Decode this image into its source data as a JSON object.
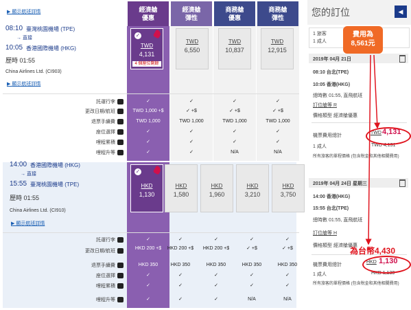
{
  "top_link": "顯示航班詳情",
  "fare_columns": [
    {
      "line1": "經濟艙",
      "line2": "優惠"
    },
    {
      "line1": "經濟艙",
      "line2": "彈性"
    },
    {
      "line1": "商務艙",
      "line2": "優惠"
    },
    {
      "line1": "商務艙",
      "line2": "彈性"
    }
  ],
  "outbound": {
    "dep_time": "08:10",
    "dep_airport": "臺灣桃園機場 (TPE)",
    "stop": "直接",
    "arr_time": "10:05",
    "arr_airport": "香港國際機場 (HKG)",
    "duration": "歷時 01:55",
    "carrier": "China Airlines Ltd. (CI903)",
    "detail_link": "顯示航班詳情",
    "fares": [
      {
        "currency": "TWD",
        "amount": "4,131",
        "tag": "4 個座位剩餘"
      },
      {
        "currency": "TWD",
        "amount": "6,550"
      },
      {
        "currency": "TWD",
        "amount": "10,837"
      },
      {
        "currency": "TWD",
        "amount": "12,915"
      }
    ],
    "rows": [
      {
        "label": "託運行李",
        "cells": [
          "✓",
          "✓",
          "✓",
          "✓"
        ]
      },
      {
        "label": "更改日期/航班",
        "cells": [
          "TWD 1,000 +$",
          "✓ +$",
          "✓ +$",
          "✓ +$"
        ]
      },
      {
        "label": "退票手續費",
        "cells": [
          "TWD 1,000",
          "TWD 1,000",
          "TWD 1,000",
          "TWD 1,000"
        ]
      },
      {
        "label": "座位選擇",
        "cells": [
          "✓",
          "✓",
          "✓",
          "✓"
        ]
      },
      {
        "label": "哩程累積",
        "cells": [
          "✓",
          "✓",
          "✓",
          "✓"
        ]
      },
      {
        "label": "哩程升等",
        "cells": [
          "✓",
          "✓",
          "N/A",
          "N/A"
        ]
      }
    ]
  },
  "inbound": {
    "dep_time": "14:00",
    "dep_airport": "香港國際機場 (HKG)",
    "stop": "直接",
    "arr_time": "15:55",
    "arr_airport": "臺灣桃園機場 (TPE)",
    "duration": "歷時 01:55",
    "carrier": "China Airlines Ltd. (CI910)",
    "detail_link": "顯示航班詳情",
    "fares": [
      {
        "currency": "HKD",
        "amount": "1,130"
      },
      {
        "currency": "HKD",
        "amount": "1,580"
      },
      {
        "currency": "HKD",
        "amount": "1,960"
      },
      {
        "currency": "HKD",
        "amount": "3,210"
      },
      {
        "currency": "HKD",
        "amount": "3,750"
      }
    ],
    "rows": [
      {
        "label": "託運行李",
        "cells": [
          "✓",
          "✓",
          "✓",
          "✓",
          "✓"
        ]
      },
      {
        "label": "更改日期/航班",
        "cells": [
          "HKD 200 +$",
          "HKD 200 +$",
          "HKD 200 +$",
          "✓ +$",
          "✓ +$"
        ]
      },
      {
        "label": "退票手續費",
        "cells": [
          "HKD 350",
          "HKD 350",
          "HKD 350",
          "HKD 350",
          "HKD 350"
        ]
      },
      {
        "label": "座位選擇",
        "cells": [
          "✓",
          "✓",
          "✓",
          "✓",
          "✓"
        ]
      },
      {
        "label": "哩程累積",
        "cells": [
          "✓",
          "✓",
          "✓",
          "✓",
          "✓"
        ]
      },
      {
        "label": "哩程升等",
        "cells": [
          "✓",
          "✓",
          "✓",
          "N/A",
          "N/A"
        ]
      }
    ]
  },
  "summary": {
    "title": "您的訂位",
    "passengers_1": "1 旅客",
    "passengers_2": "1 成人",
    "seg1": {
      "date": "2019年 04月 21日",
      "dep": "08:10 台北(TPE)",
      "arr": "10:05 香港(HKG)",
      "dur": "總時數 01:55, 直飛航班",
      "fare_link": "訂位艙等 R",
      "fare_type": "價格類型 經濟艙優惠",
      "total_label": "機票費用總計",
      "total_cur": "TWD",
      "total_amt": "4,131",
      "adult_label": "1 成人",
      "adult_amt": "TWD 4,131",
      "note": "所有旅客的單程價格 (包含稅金和其他相關費用)"
    },
    "seg2": {
      "date": "2019年 04月 24日 星期三",
      "dep": "14:00 香港(HKG)",
      "arr": "15:55 台北(TPE)",
      "dur": "總時數 01:55, 直飛航班",
      "fare_link": "訂位艙等 H",
      "fare_type": "價格類型 經濟艙優惠",
      "total_label": "機票費用總計",
      "total_cur": "HKD",
      "total_amt": "1,130",
      "adult_label": "1 成人",
      "adult_amt": "HKD 1,130",
      "note": "所有旅客的單程價格 (包含稅金和其他相關費用)"
    }
  },
  "annotations": {
    "callout_line1": "費用為",
    "callout_line2": "8,561元",
    "twd_text": "為台幣4,430"
  }
}
